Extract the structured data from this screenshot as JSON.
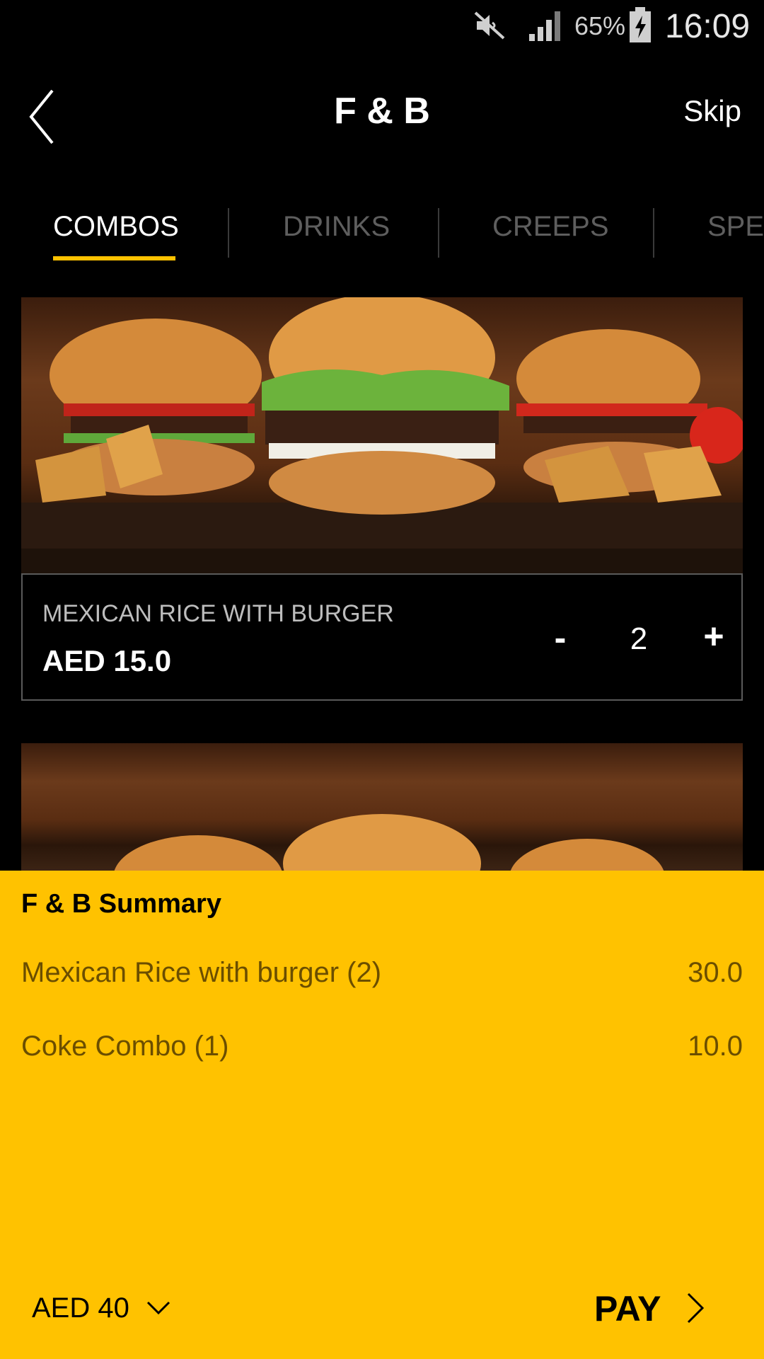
{
  "status_bar": {
    "battery_percent": "65%",
    "time": "16:09",
    "icons": [
      "mute-icon",
      "signal-icon",
      "battery-charging-icon"
    ]
  },
  "header": {
    "title": "F & B",
    "back_icon": "chevron-left-icon",
    "skip_label": "Skip"
  },
  "tabs": [
    {
      "label": "COMBOS",
      "active": true
    },
    {
      "label": "DRINKS",
      "active": false
    },
    {
      "label": "CREEPS",
      "active": false
    },
    {
      "label": "SPE",
      "active": false
    }
  ],
  "products": [
    {
      "name": "MEXICAN RICE WITH BURGER",
      "price": "AED 15.0",
      "quantity": "2",
      "minus_label": "-",
      "plus_label": "+"
    }
  ],
  "summary": {
    "title": "F & B Summary",
    "items": [
      {
        "label": "Mexican Rice with burger (2)",
        "value": "30.0"
      },
      {
        "label": "Coke Combo (1)",
        "value": "10.0"
      }
    ],
    "total": "AED 40",
    "pay_label": "PAY"
  },
  "colors": {
    "accent": "#ffc200",
    "background": "#000000",
    "inactive_tab": "#5e5e5e"
  }
}
